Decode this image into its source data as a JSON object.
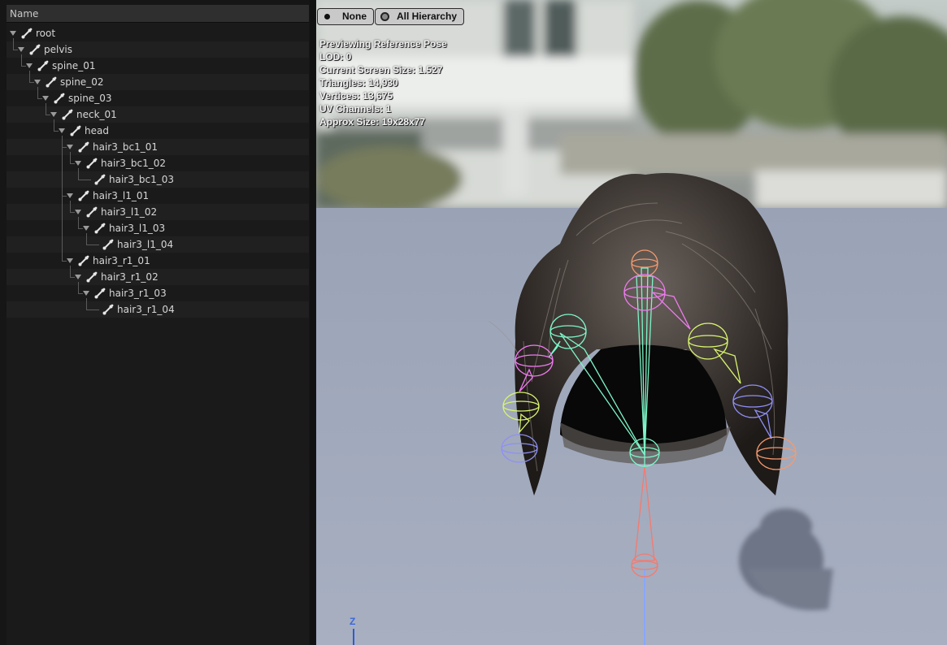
{
  "tree": {
    "header": "Name",
    "rows": [
      {
        "label": "root",
        "depth": 0
      },
      {
        "label": "pelvis",
        "depth": 1
      },
      {
        "label": "spine_01",
        "depth": 2
      },
      {
        "label": "spine_02",
        "depth": 3
      },
      {
        "label": "spine_03",
        "depth": 4
      },
      {
        "label": "neck_01",
        "depth": 5
      },
      {
        "label": "head",
        "depth": 6
      },
      {
        "label": "hair3_bc1_01",
        "depth": 7
      },
      {
        "label": "hair3_bc1_02",
        "depth": 8
      },
      {
        "label": "hair3_bc1_03",
        "depth": 9
      },
      {
        "label": "hair3_l1_01",
        "depth": 7
      },
      {
        "label": "hair3_l1_02",
        "depth": 8
      },
      {
        "label": "hair3_l1_03",
        "depth": 9
      },
      {
        "label": "hair3_l1_04",
        "depth": 10
      },
      {
        "label": "hair3_r1_01",
        "depth": 7
      },
      {
        "label": "hair3_r1_02",
        "depth": 8
      },
      {
        "label": "hair3_r1_03",
        "depth": 9
      },
      {
        "label": "hair3_r1_04",
        "depth": 10
      }
    ]
  },
  "viewport": {
    "buttons": {
      "none_label": "None",
      "all_hierarchy_label": "All Hierarchy"
    },
    "stats": {
      "line1": "Previewing Reference Pose",
      "line2": "LOD: 0",
      "line3": "Current Screen Size: 1.527",
      "line4": "Triangles: 14,930",
      "line5": "Vertices: 13,675",
      "line6": "UV Channels: 1",
      "line7": "Approx Size: 19x28x77"
    },
    "axis_label": "Z"
  },
  "icons": {
    "bone": "bone-icon",
    "expand": "chevron-down-icon"
  },
  "colors": {
    "bone_cyan": "#7df5c8",
    "bone_pink": "#f07af0",
    "bone_lime": "#d8f56e",
    "bone_blue": "#8f8ff5",
    "bone_orange": "#f59a6e",
    "bone_red": "#f57a6e"
  }
}
